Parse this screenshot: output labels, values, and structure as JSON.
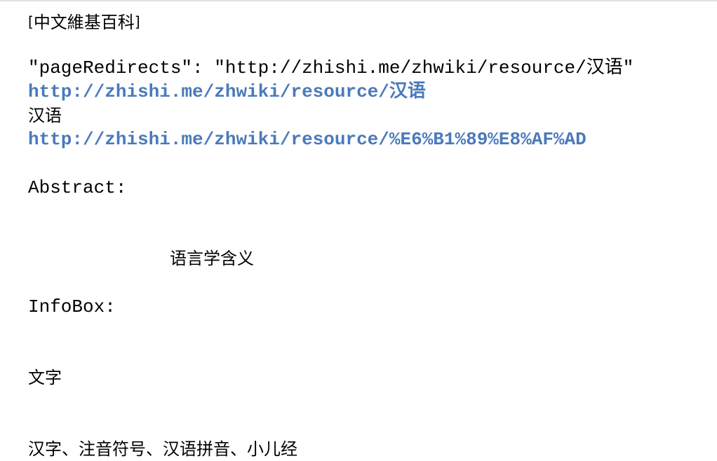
{
  "source": {
    "open_bracket": "[",
    "name": "中文維基百科",
    "close_bracket": "]"
  },
  "page_redirects_line": "\"pageRedirects\": \"http://zhishi.me/zhwiki/resource/汉语\"",
  "redirect_link": "http://zhishi.me/zhwiki/resource/汉语",
  "term": "汉语",
  "encoded_link": "http://zhishi.me/zhwiki/resource/%E6%B1%89%E8%AF%AD",
  "abstract": {
    "label": "Abstract:",
    "text": "语言学含义"
  },
  "infobox": {
    "label": "InfoBox:",
    "key": "文字",
    "value": "汉字、注音符号、汉语拼音、小儿经"
  },
  "colors": {
    "link": "#4a7aba",
    "text": "#000000",
    "background": "#ffffff"
  }
}
